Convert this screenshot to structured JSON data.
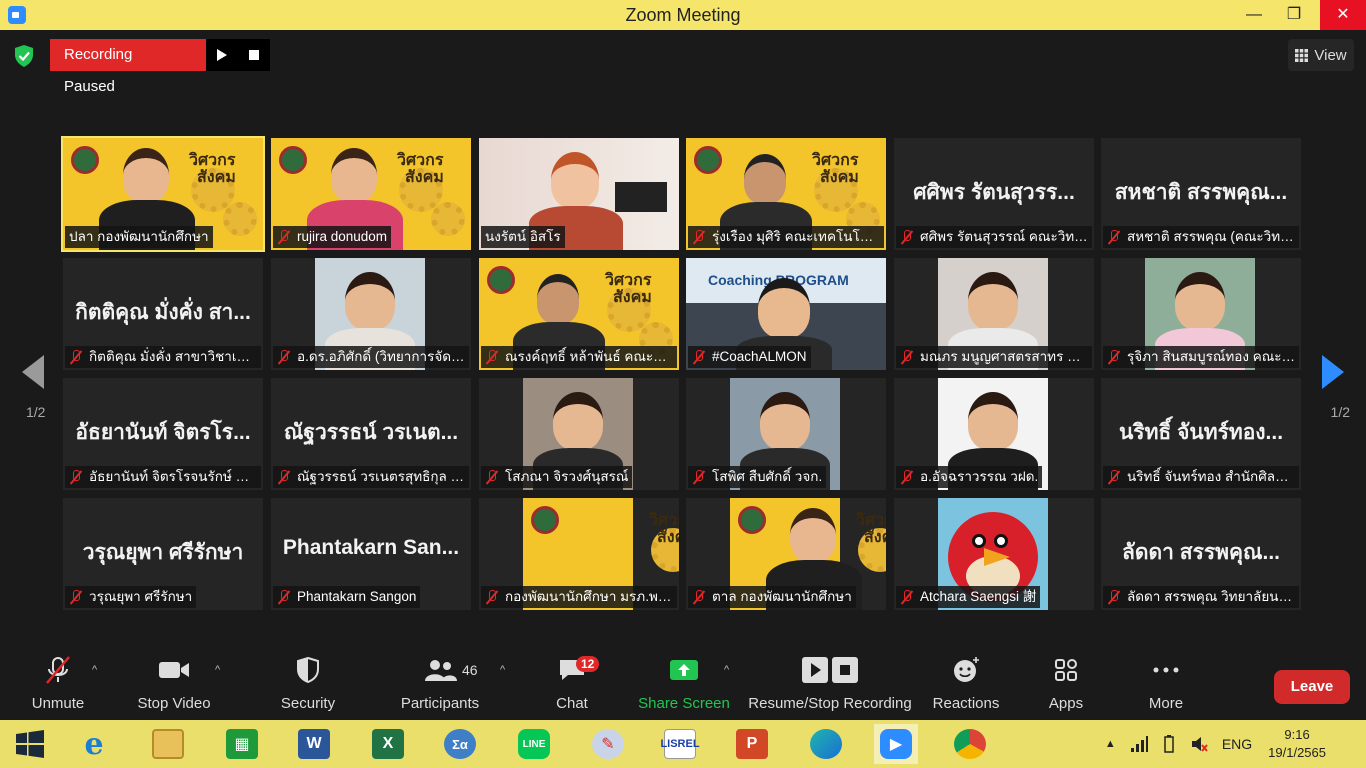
{
  "window": {
    "title": "Zoom Meeting",
    "minimize": "—",
    "maximize": "❐",
    "close": "✕"
  },
  "top": {
    "recording_label": "Recording Paused",
    "view_label": "View"
  },
  "pager": {
    "left": "1/2",
    "right": "1/2"
  },
  "tiles": [
    {
      "name": "ปลา กองพัฒนานักศึกษา",
      "big": "",
      "muted": false,
      "kind": "banner-woman"
    },
    {
      "name": "rujira donudom",
      "big": "",
      "muted": true,
      "kind": "banner-woman2"
    },
    {
      "name": "นงรัตน์ อิสโร",
      "big": "",
      "muted": false,
      "kind": "room-woman"
    },
    {
      "name": "รุ่งเรือง มุศิริ คณะเทคโนโลยีอุ...",
      "big": "",
      "muted": true,
      "kind": "banner-man"
    },
    {
      "name": "ศศิพร รัตนสุวรรณ์ คณะวิทยาศ...",
      "big": "ศศิพร  รัตนสุวรร...",
      "muted": true,
      "kind": "none"
    },
    {
      "name": "สหชาติ สรรพคุณ (คณะวิทยาศ...",
      "big": "สหชาติ  สรรพคุณ...",
      "muted": true,
      "kind": "none"
    },
    {
      "name": "กิตติคุณ  มั่งคั่ง สาขาวิชาเทคโ...",
      "big": "กิตติคุณ  มั่งคั่ง  สา...",
      "muted": true,
      "kind": "none"
    },
    {
      "name": "อ.ดร.อภิศักดิ์ (วิทยาการจัดการ)",
      "big": "",
      "muted": true,
      "kind": "photo-man"
    },
    {
      "name": "ณรงค์ฤทธิ์ หล้าพันธ์ คณะวิทย...",
      "big": "",
      "muted": true,
      "kind": "banner-man2"
    },
    {
      "name": "#CoachALMON",
      "big": "",
      "muted": true,
      "kind": "coach"
    },
    {
      "name": "มณภร มนูญศาสตรสาทร คณะวิทย...",
      "big": "",
      "muted": true,
      "kind": "photo-woman"
    },
    {
      "name": "รุจิภา สินสมบูรณ์ทอง คณะวิทย...",
      "big": "",
      "muted": true,
      "kind": "photo-girl"
    },
    {
      "name": "อัธยานันท์ จิตรโรจนรักษ์ คณะ...",
      "big": "อัธยานันท์  จิตรโร...",
      "muted": true,
      "kind": "none"
    },
    {
      "name": "ณัฐวรรธน์ วรเนตรสุทธิกุล มนุษย...",
      "big": "ณัฐวรรธน์  วรเนต...",
      "muted": true,
      "kind": "none"
    },
    {
      "name": "โสภณา จิรวงศ์นุสรณ์",
      "big": "",
      "muted": true,
      "kind": "photo-woman2"
    },
    {
      "name": "โสพิศ สืบศักดิ์ วจก.",
      "big": "",
      "muted": true,
      "kind": "photo-woman3"
    },
    {
      "name": "อ.อัจฉราวรรณ วฝด.",
      "big": "",
      "muted": true,
      "kind": "photo-woman4"
    },
    {
      "name": "นริทธิ์ จันทร์ทอง สำนักศิลปะ...",
      "big": "นริทธิ์  จันทร์ทอง...",
      "muted": true,
      "kind": "none"
    },
    {
      "name": "วรุณยุพา ศรีรักษา",
      "big": "วรุณยุพา  ศรีรักษา",
      "muted": true,
      "kind": "none"
    },
    {
      "name": "Phantakarn Sangon",
      "big": "Phantakarn  San...",
      "muted": true,
      "kind": "none"
    },
    {
      "name": "กองพัฒนานักศึกษา มรภ.พระนคร",
      "big": "",
      "muted": true,
      "kind": "banner-logo"
    },
    {
      "name": "ตาล กองพัฒนานักศึกษา",
      "big": "",
      "muted": true,
      "kind": "banner-woman3"
    },
    {
      "name": "Atchara Saengsi 謝",
      "big": "",
      "muted": true,
      "kind": "angry-bird"
    },
    {
      "name": "ลัดดา สรรพคุณ  วิทยาลัยนวัต...",
      "big": "ลัดดา  สรรพคุณ...",
      "muted": true,
      "kind": "none"
    }
  ],
  "banner_text": {
    "line1": "วิศวกร",
    "line2": "สังคม"
  },
  "coach_text": "Coaching PROGRAM",
  "toolbar": {
    "unmute": "Unmute",
    "stop_video": "Stop Video",
    "security": "Security",
    "participants": "Participants",
    "participants_count": "46",
    "chat": "Chat",
    "chat_badge": "12",
    "share_screen": "Share Screen",
    "recording": "Resume/Stop Recording",
    "reactions": "Reactions",
    "apps": "Apps",
    "more": "More",
    "leave": "Leave"
  },
  "taskbar": {
    "lang": "ENG",
    "time": "9:16",
    "date": "19/1/2565",
    "apps": [
      "start",
      "ie",
      "explorer",
      "store",
      "word",
      "excel",
      "math",
      "line",
      "paint",
      "lisrel",
      "powerpoint",
      "edge",
      "zoom",
      "chrome"
    ]
  },
  "colors": {
    "title_bar": "#f5e56b",
    "recording_red": "#e02828",
    "share_green": "#23c552",
    "zoom_blue": "#2d8cff",
    "leave_red": "#d02a2a",
    "banner_yellow": "#f3c52a"
  }
}
